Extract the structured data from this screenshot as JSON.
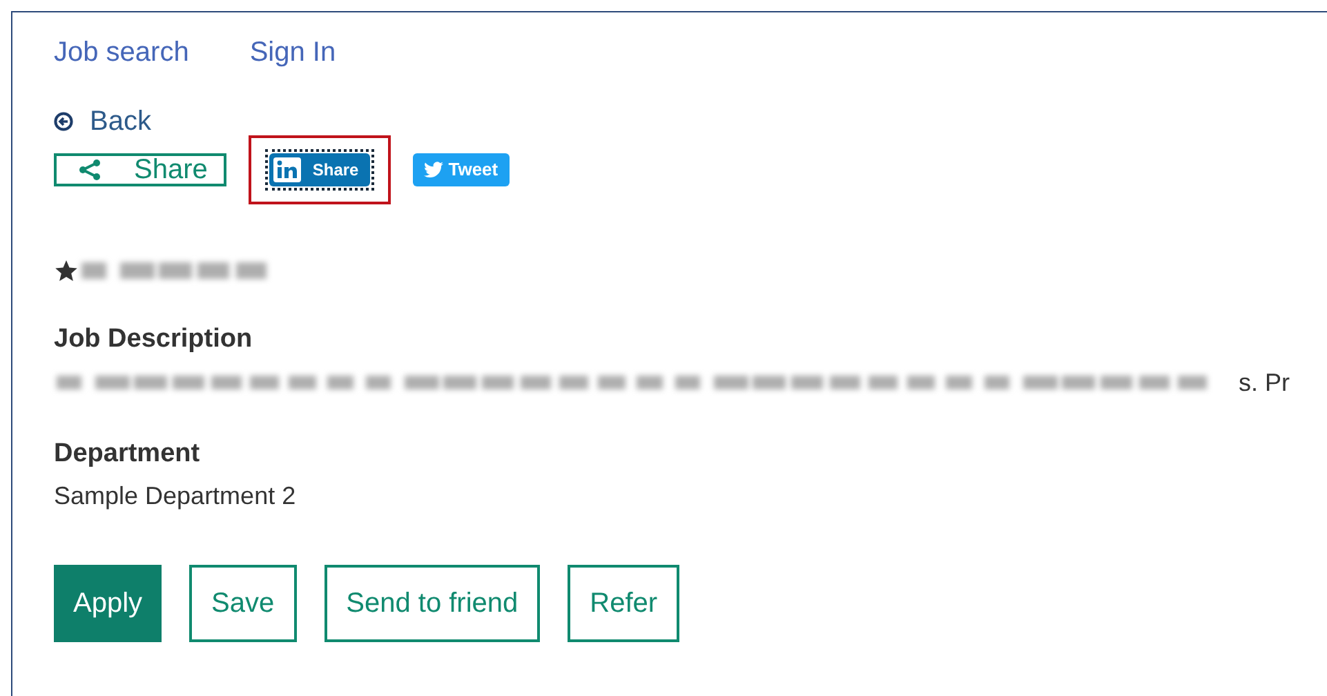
{
  "nav": [
    "Job search",
    "Sign In"
  ],
  "back": {
    "label": "Back"
  },
  "share_buttons": [
    {
      "kind": "share",
      "label": "Share",
      "focused": false
    },
    {
      "kind": "linkedin",
      "label": "Share",
      "focused": true
    },
    {
      "kind": "twitter",
      "label": "Tweet",
      "focused": false
    }
  ],
  "job": {
    "starred": true,
    "title": {
      "kind": "blurred"
    }
  },
  "sections": [
    {
      "heading": "Job Description",
      "blurred": true,
      "text": "s. Pr"
    },
    {
      "heading": "Department",
      "blurred": false,
      "text": "Sample Department 2"
    }
  ],
  "actions": [
    {
      "label": "Apply",
      "kind": "filled"
    },
    {
      "label": "Save",
      "kind": "outline"
    },
    {
      "label": "Send to friend",
      "kind": "outline"
    },
    {
      "label": "Refer",
      "kind": "outline"
    }
  ]
}
